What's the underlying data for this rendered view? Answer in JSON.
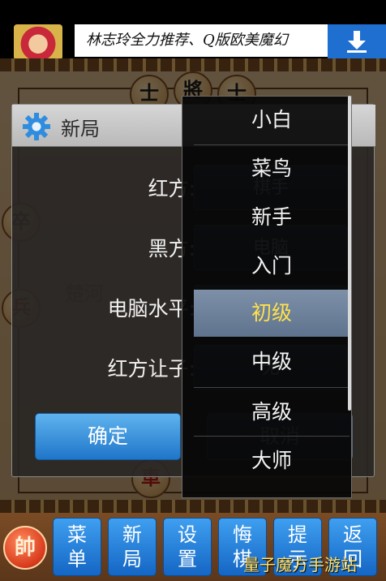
{
  "ad": {
    "text": "林志玲全力推荐、Q版欧美魔幻",
    "avatar_icon": "game-character-avatar",
    "download_icon": "download-arrow-icon"
  },
  "board": {
    "river_text": "楚河",
    "pieces": {
      "shi_left": "士",
      "jiang": "將",
      "shi_right": "士",
      "zu_left": "卒",
      "bing_left": "兵",
      "ju_bottom": "車"
    }
  },
  "dialog": {
    "title": "新局",
    "fields": [
      {
        "label": "红方:",
        "value": "棋手"
      },
      {
        "label": "黑方:",
        "value": "电脑"
      },
      {
        "label": "电脑水平:",
        "value": "初级"
      },
      {
        "label": "红方让子:",
        "value": "无"
      }
    ],
    "ok_label": "确定",
    "cancel_label": "取消"
  },
  "level_list": {
    "items": [
      "小白",
      "菜鸟",
      "新手",
      "入门",
      "初级",
      "中级",
      "高级",
      "大师"
    ],
    "selected": "初级"
  },
  "toolbar": {
    "piece_label": "帥",
    "buttons": [
      {
        "line1": "菜",
        "line2": "单"
      },
      {
        "line1": "新",
        "line2": "局"
      },
      {
        "line1": "设",
        "line2": "置"
      },
      {
        "line1": "悔",
        "line2": "棋"
      },
      {
        "line1": "提",
        "line2": "示"
      },
      {
        "line1": "返",
        "line2": "回"
      }
    ]
  },
  "watermark": "量子魔方手游站",
  "colors": {
    "accent_blue": "#1f76c9",
    "selected_text": "#ffe14a",
    "red_piece": "#d83a1c"
  }
}
